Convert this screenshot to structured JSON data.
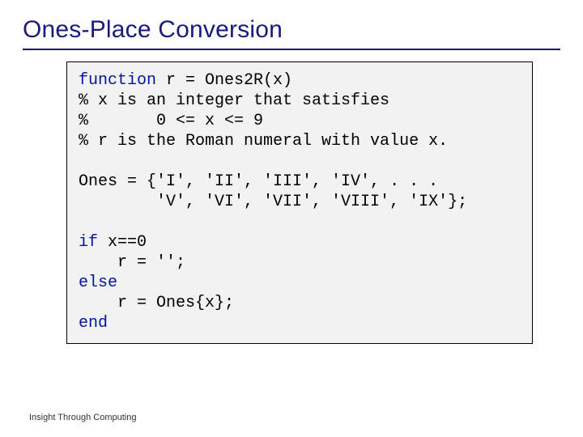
{
  "title": "Ones-Place Conversion",
  "code": {
    "l1a": "function",
    "l1b": " r = Ones2R(x)",
    "l2": "% x is an integer that satisfies",
    "l3": "%       0 <= x <= 9",
    "l4": "% r is the Roman numeral with value x.",
    "blank1": " ",
    "l5": "Ones = {'I', 'II', 'III', 'IV', . . .",
    "l6": "        'V', 'VI', 'VII', 'VIII', 'IX'};",
    "blank2": " ",
    "l7a": "if",
    "l7b": " x==0",
    "l8": "    r = '';",
    "l9": "else",
    "l10": "    r = Ones{x};",
    "l11": "end"
  },
  "footer": "Insight Through Computing"
}
